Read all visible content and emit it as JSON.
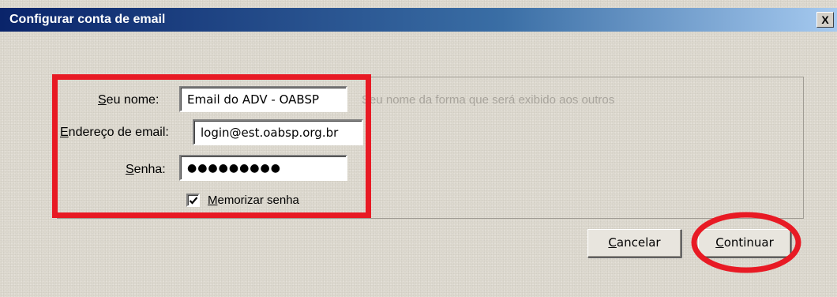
{
  "window": {
    "title": "Configurar conta de email",
    "close_label": "X"
  },
  "form": {
    "name": {
      "label_underlined": "S",
      "label_rest": "eu nome:",
      "value": "Email do ADV - OABSP",
      "hint": "Seu nome da forma que será exibido aos outros"
    },
    "email": {
      "label_underlined": "E",
      "label_rest": "ndereço de email:",
      "value": "login@est.oabsp.org.br"
    },
    "password": {
      "label_underlined": "S",
      "label_rest": "enha:",
      "masked_value": "●●●●●●●●●"
    },
    "remember": {
      "label_underlined": "M",
      "label_rest": "emorizar senha",
      "checked": true
    }
  },
  "buttons": {
    "cancel": {
      "underlined": "C",
      "rest": "ancelar"
    },
    "continue": {
      "underlined": "C",
      "rest": "ontinuar"
    }
  },
  "colors": {
    "annotation_red": "#e81a24",
    "dialog_background": "#ddd9cf",
    "titlebar_start": "#0a246a"
  },
  "icons": {
    "close": "close-icon",
    "checkbox": "checkmark-icon"
  }
}
